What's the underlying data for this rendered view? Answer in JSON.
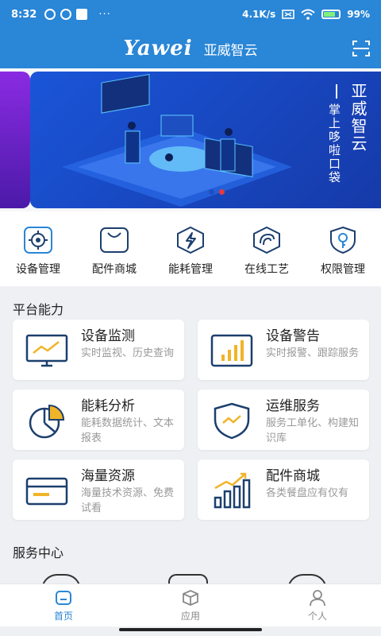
{
  "status": {
    "time": "8:32",
    "speed": "4.1K/s",
    "battery": "99",
    "dots": "···"
  },
  "header": {
    "logo": "Yawei",
    "title": "亚威智云"
  },
  "banner": {
    "title": "亚威智云",
    "subtitle": "掌上哆啦口袋"
  },
  "menu": [
    {
      "label": "设备管理",
      "icon": "gear-icon"
    },
    {
      "label": "配件商城",
      "icon": "shopping-bag-icon"
    },
    {
      "label": "能耗管理",
      "icon": "lightning-icon"
    },
    {
      "label": "在线工艺",
      "icon": "process-icon"
    },
    {
      "label": "权限管理",
      "icon": "key-shield-icon"
    }
  ],
  "sections": {
    "platform": "平台能力",
    "service": "服务中心"
  },
  "tiles": [
    {
      "title": "设备监测",
      "desc": "实时监视、历史查询",
      "icon": "monitor-icon"
    },
    {
      "title": "设备警告",
      "desc": "实时报警、跟踪服务",
      "icon": "bar-chart-icon"
    },
    {
      "title": "能耗分析",
      "desc": "能耗数据统计、文本报表",
      "icon": "pie-chart-icon"
    },
    {
      "title": "运维服务",
      "desc": "服务工单化、构建知识库",
      "icon": "shield-icon"
    },
    {
      "title": "海量资源",
      "desc": "海量技术资源、免费试看",
      "icon": "card-icon"
    },
    {
      "title": "配件商城",
      "desc": "各类餐盘应有仅有",
      "icon": "growth-chart-icon"
    }
  ],
  "tabs": [
    {
      "label": "首页",
      "icon": "home-icon",
      "active": true
    },
    {
      "label": "应用",
      "icon": "cube-icon",
      "active": false
    },
    {
      "label": "个人",
      "icon": "person-icon",
      "active": false
    }
  ],
  "colors": {
    "primary": "#2a86d6",
    "accent": "#f0b429",
    "navy": "#1c3f6e"
  }
}
